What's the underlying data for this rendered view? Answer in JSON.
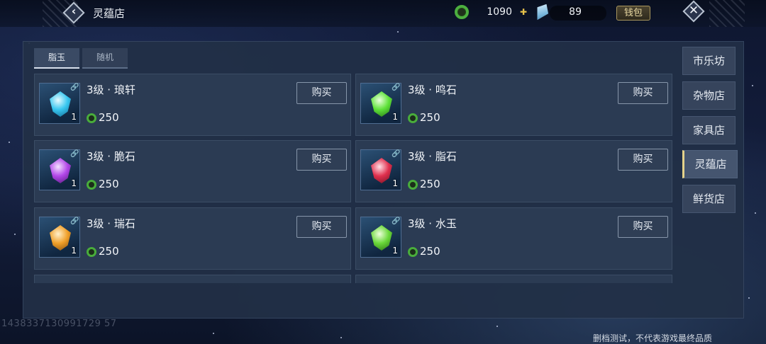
{
  "header": {
    "title": "灵蕴店",
    "currency1_value": "1090",
    "currency2_value": "89",
    "wallet_label": "钱包",
    "back_icon": "chevron-left-icon",
    "close_icon": "close-icon"
  },
  "tabs": [
    {
      "label": "脂玉",
      "active": true
    },
    {
      "label": "随机",
      "active": false
    }
  ],
  "items": [
    {
      "name": "3级 · 琅轩",
      "qty": "1",
      "price": "250",
      "buy_label": "购买",
      "gem_color": "#38c7f0"
    },
    {
      "name": "3级 · 鸣石",
      "qty": "1",
      "price": "250",
      "buy_label": "购买",
      "gem_color": "#5fe23a"
    },
    {
      "name": "3级 · 脆石",
      "qty": "1",
      "price": "250",
      "buy_label": "购买",
      "gem_color": "#b247e8"
    },
    {
      "name": "3级 · 脂石",
      "qty": "1",
      "price": "250",
      "buy_label": "购买",
      "gem_color": "#e0304e"
    },
    {
      "name": "3级 · 瑞石",
      "qty": "1",
      "price": "250",
      "buy_label": "购买",
      "gem_color": "#f0a02a"
    },
    {
      "name": "3级 · 水玉",
      "qty": "1",
      "price": "250",
      "buy_label": "购买",
      "gem_color": "#6ad83a"
    }
  ],
  "side_nav": [
    {
      "label": "市乐坊",
      "active": false
    },
    {
      "label": "杂物店",
      "active": false
    },
    {
      "label": "家具店",
      "active": false
    },
    {
      "label": "灵蕴店",
      "active": true
    },
    {
      "label": "鲜货店",
      "active": false
    }
  ],
  "footer": {
    "uid": "1438337130991729 57",
    "notice": "删档测试，不代表游戏最终品质"
  },
  "colors": {
    "accent_gold": "#e4d28a",
    "price_green": "#49ad3b"
  }
}
